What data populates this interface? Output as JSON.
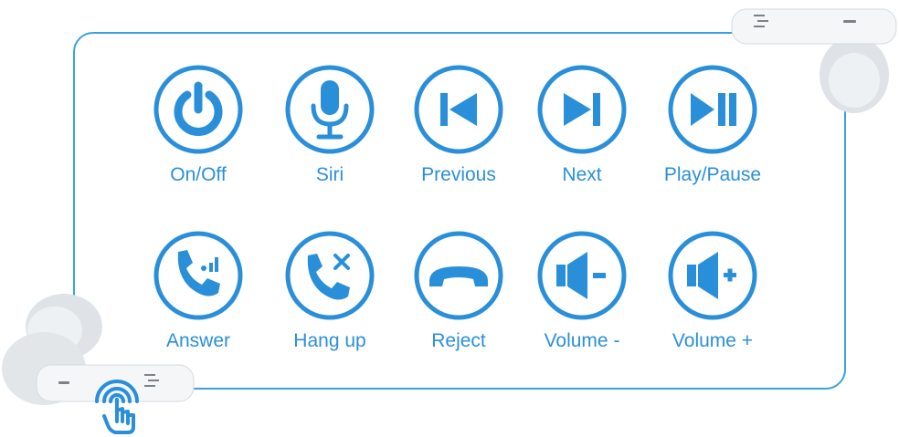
{
  "controls": [
    {
      "id": "on-off",
      "label": "On/Off",
      "icon": "power-icon"
    },
    {
      "id": "siri",
      "label": "Siri",
      "icon": "microphone-icon"
    },
    {
      "id": "previous",
      "label": "Previous",
      "icon": "previous-track-icon"
    },
    {
      "id": "next",
      "label": "Next",
      "icon": "next-track-icon"
    },
    {
      "id": "play-pause",
      "label": "Play/Pause",
      "icon": "play-pause-icon"
    },
    {
      "id": "answer",
      "label": "Answer",
      "icon": "phone-answer-icon"
    },
    {
      "id": "hang-up",
      "label": "Hang up",
      "icon": "phone-hangup-icon"
    },
    {
      "id": "reject",
      "label": "Reject",
      "icon": "phone-reject-icon"
    },
    {
      "id": "volume-down",
      "label": "Volume -",
      "icon": "volume-down-icon"
    },
    {
      "id": "volume-up",
      "label": "Volume +",
      "icon": "volume-up-icon"
    }
  ],
  "colors": {
    "accent": "#2a8fd9",
    "border": "#3aa0e6",
    "earbud": "#e9ecef"
  }
}
